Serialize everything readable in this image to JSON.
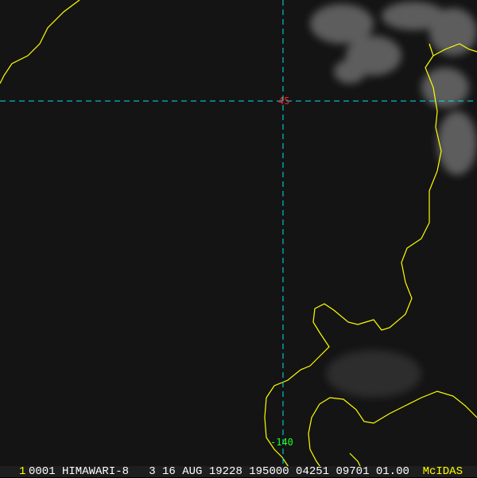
{
  "image": {
    "satellite_info": "0001 HIMAWARI-8   3 16 AUG 19228 195000 04251 09701 01.00",
    "frame_number": "1",
    "software_logo": "McIDAS",
    "latitude_label": "45",
    "longitude_label": "-140",
    "colors": {
      "coastline": "#ffff00",
      "gridline": "#00e5ee",
      "latitude_label": "#ff2020",
      "longitude_label": "#20ff20",
      "background": "#141414"
    }
  }
}
